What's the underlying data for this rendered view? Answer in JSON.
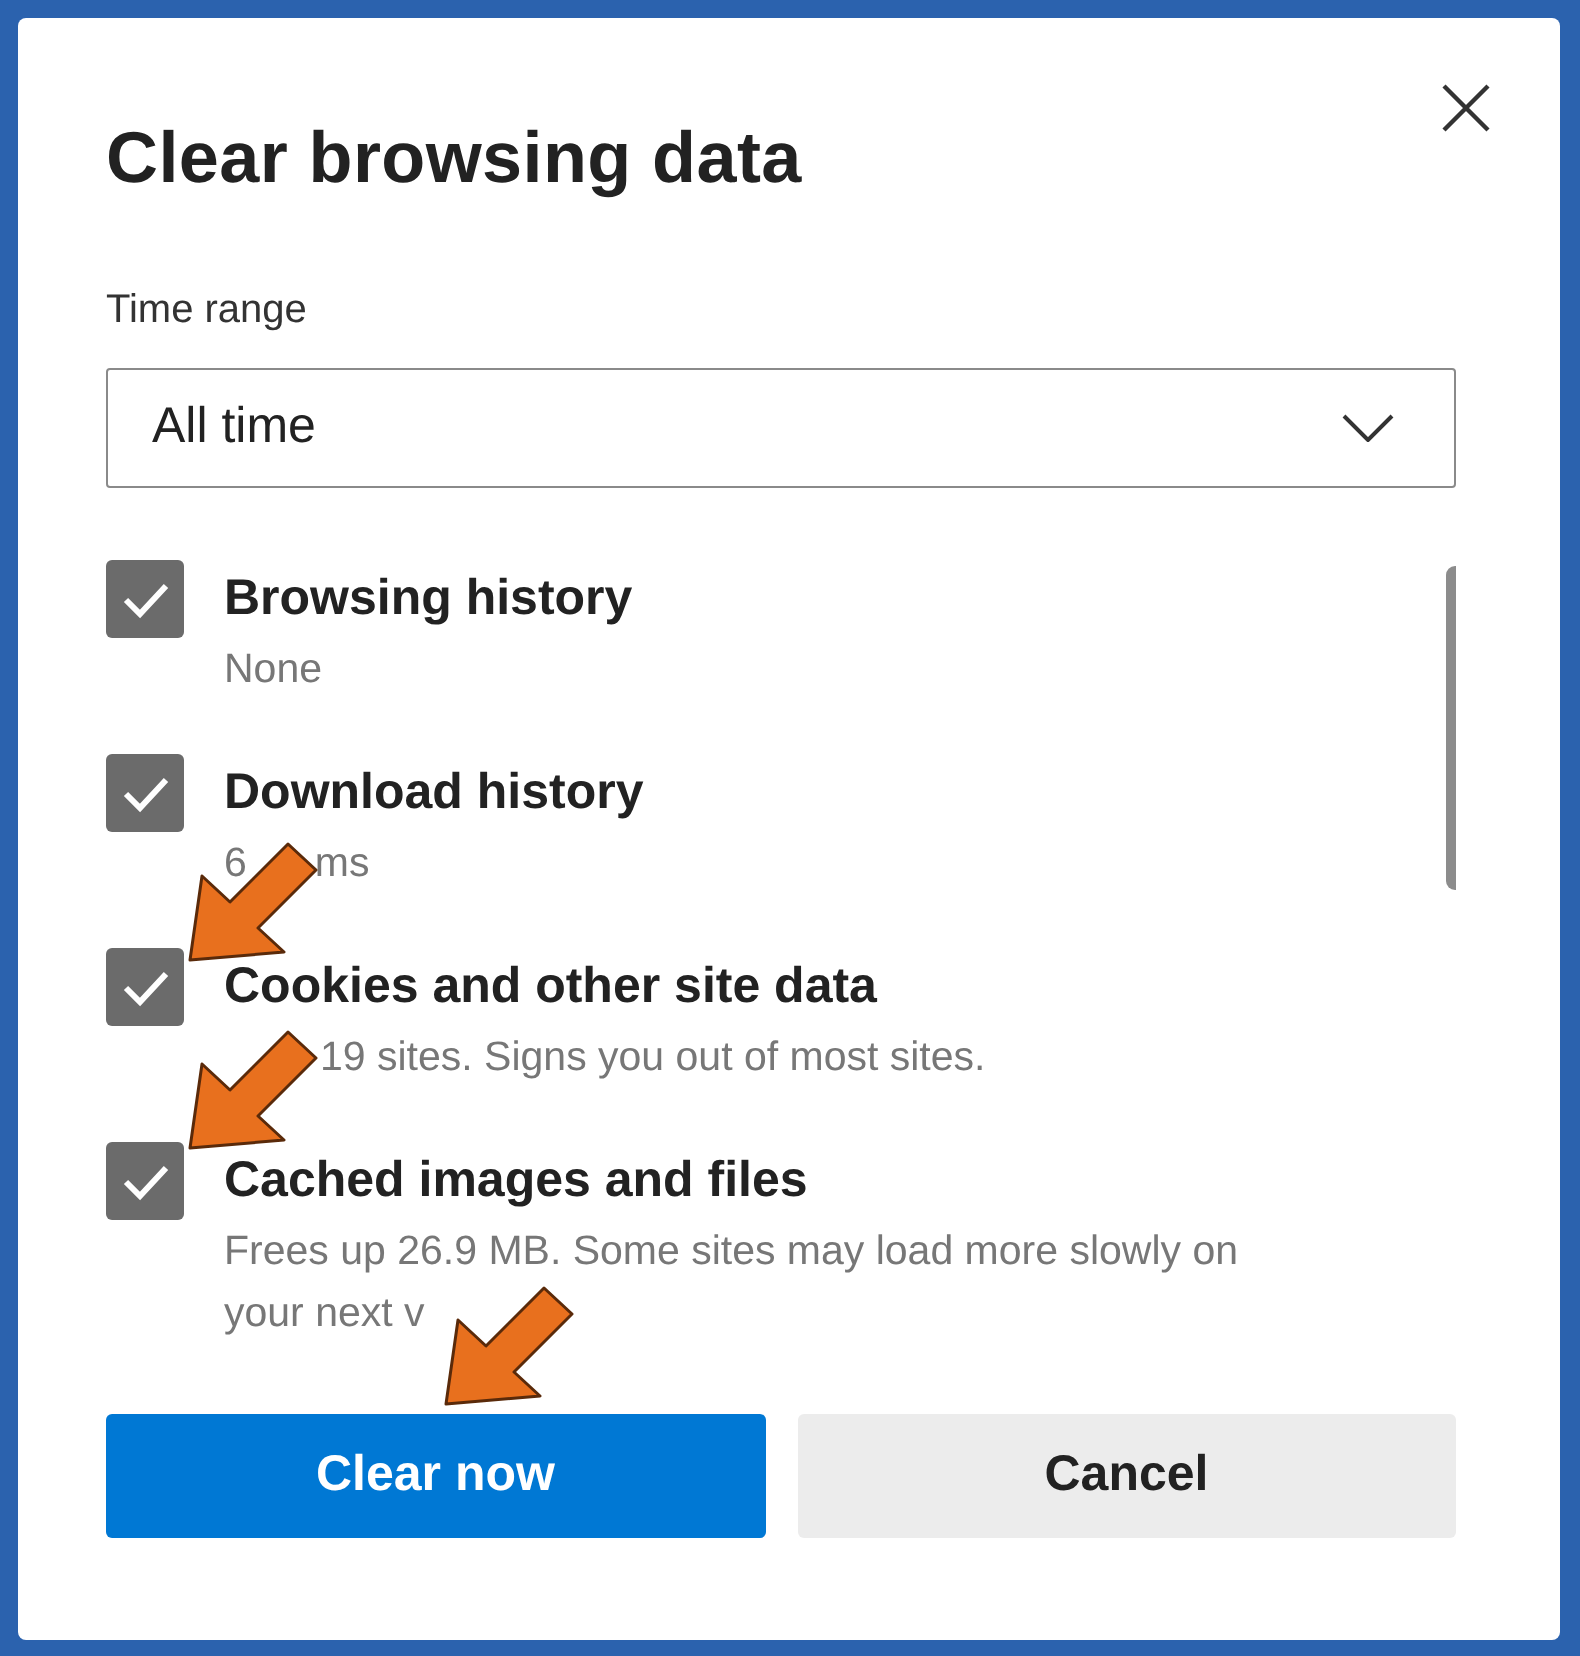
{
  "dialog": {
    "title": "Clear browsing data"
  },
  "time_range": {
    "label": "Time range",
    "value": "All time"
  },
  "items": [
    {
      "title": "Browsing history",
      "checked": true,
      "description": [
        [
          "None"
        ]
      ]
    },
    {
      "title": "Download history",
      "checked": true,
      "description": [
        [
          "6",
          "ms"
        ]
      ]
    },
    {
      "title": "Cookies and other site data",
      "checked": true,
      "description": [
        [
          "19 sites. Signs you out of most sites."
        ]
      ]
    },
    {
      "title": "Cached images and files",
      "checked": true,
      "description": [
        [
          "Frees up 26.9 MB. Some sites may load more slowly on"
        ],
        [
          "your next v"
        ]
      ]
    }
  ],
  "buttons": [
    {
      "label": "Clear now",
      "kind": "primary"
    },
    {
      "label": "Cancel",
      "kind": "secondary"
    }
  ]
}
